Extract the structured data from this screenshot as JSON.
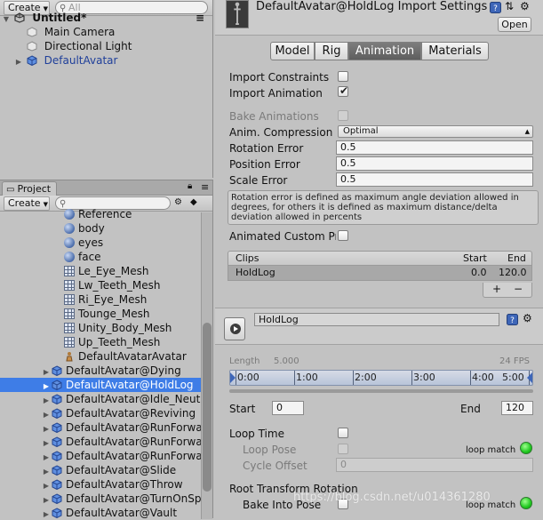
{
  "hierarchy": {
    "create_label": "Create",
    "search_placeholder": "All",
    "scene_name": "Untitled*",
    "items": [
      {
        "label": "Main Camera"
      },
      {
        "label": "Directional Light"
      },
      {
        "label": "DefaultAvatar"
      }
    ]
  },
  "project": {
    "tab_label": "Project",
    "create_label": "Create",
    "items": [
      {
        "label": "Reference",
        "icon": "sphere-icon"
      },
      {
        "label": "body",
        "icon": "sphere-icon"
      },
      {
        "label": "eyes",
        "icon": "sphere-icon"
      },
      {
        "label": "face",
        "icon": "sphere-icon"
      },
      {
        "label": "Le_Eye_Mesh",
        "icon": "mesh-icon"
      },
      {
        "label": "Lw_Teeth_Mesh",
        "icon": "mesh-icon"
      },
      {
        "label": "Ri_Eye_Mesh",
        "icon": "mesh-icon"
      },
      {
        "label": "Tounge_Mesh",
        "icon": "mesh-icon"
      },
      {
        "label": "Unity_Body_Mesh",
        "icon": "mesh-icon"
      },
      {
        "label": "Up_Teeth_Mesh",
        "icon": "mesh-icon"
      },
      {
        "label": "DefaultAvatarAvatar",
        "icon": "avatar-icon"
      },
      {
        "label": "DefaultAvatar@Dying",
        "icon": "prefab-icon"
      },
      {
        "label": "DefaultAvatar@HoldLog",
        "icon": "prefab-icon",
        "selected": true
      },
      {
        "label": "DefaultAvatar@Idle_Neutr",
        "icon": "prefab-icon"
      },
      {
        "label": "DefaultAvatar@Reviving",
        "icon": "prefab-icon"
      },
      {
        "label": "DefaultAvatar@RunForwar",
        "icon": "prefab-icon"
      },
      {
        "label": "DefaultAvatar@RunForwar",
        "icon": "prefab-icon"
      },
      {
        "label": "DefaultAvatar@RunForwar",
        "icon": "prefab-icon"
      },
      {
        "label": "DefaultAvatar@Slide",
        "icon": "prefab-icon"
      },
      {
        "label": "DefaultAvatar@Throw",
        "icon": "prefab-icon"
      },
      {
        "label": "DefaultAvatar@TurnOnSpo",
        "icon": "prefab-icon"
      },
      {
        "label": "DefaultAvatar@Vault",
        "icon": "prefab-icon"
      }
    ]
  },
  "inspector": {
    "title": "DefaultAvatar@HoldLog Import Settings",
    "open_label": "Open",
    "tabs": [
      {
        "label": "Model",
        "active": false
      },
      {
        "label": "Rig",
        "active": false
      },
      {
        "label": "Animation",
        "active": true
      },
      {
        "label": "Materials",
        "active": false
      }
    ],
    "import_constraints_label": "Import Constraints",
    "import_constraints_checked": false,
    "import_animation_label": "Import Animation",
    "import_animation_checked": true,
    "bake_animations_label": "Bake Animations",
    "anim_compression_label": "Anim. Compression",
    "anim_compression_value": "Optimal",
    "rotation_error_label": "Rotation Error",
    "rotation_error_value": "0.5",
    "position_error_label": "Position Error",
    "position_error_value": "0.5",
    "scale_error_label": "Scale Error",
    "scale_error_value": "0.5",
    "help_text": "Rotation error is defined as maximum angle deviation allowed in degrees, for others it is defined as maximum distance/delta deviation allowed in percents",
    "animated_custom_label": "Animated Custom Pro",
    "clips": {
      "header_clips": "Clips",
      "header_start": "Start",
      "header_end": "End",
      "rows": [
        {
          "name": "HoldLog",
          "start": "0.0",
          "end": "120.0"
        }
      ],
      "add_label": "+",
      "remove_label": "−"
    },
    "clip": {
      "name": "HoldLog",
      "length_label": "Length",
      "length_value": "5.000",
      "fps": "24 FPS",
      "timeline_ticks": [
        "0:00",
        "1:00",
        "2:00",
        "3:00",
        "4:00",
        "5:00"
      ],
      "start_label": "Start",
      "start_value": "0",
      "end_label": "End",
      "end_value": "120",
      "loop_time_label": "Loop Time",
      "loop_pose_label": "Loop Pose",
      "loop_match_label": "loop match",
      "loop_match_label_2": "loop match",
      "cycle_offset_label": "Cycle Offset",
      "cycle_offset_value": "0",
      "root_rotation_label": "Root Transform Rotation",
      "bake_into_pose_label": "Bake Into Pose"
    }
  },
  "watermark": "https://blog.csdn.net/u014361280",
  "colors": {
    "selection": "#3e7de7",
    "panel_bg": "#c2c2c2",
    "loop_match": "#1fc81f"
  }
}
